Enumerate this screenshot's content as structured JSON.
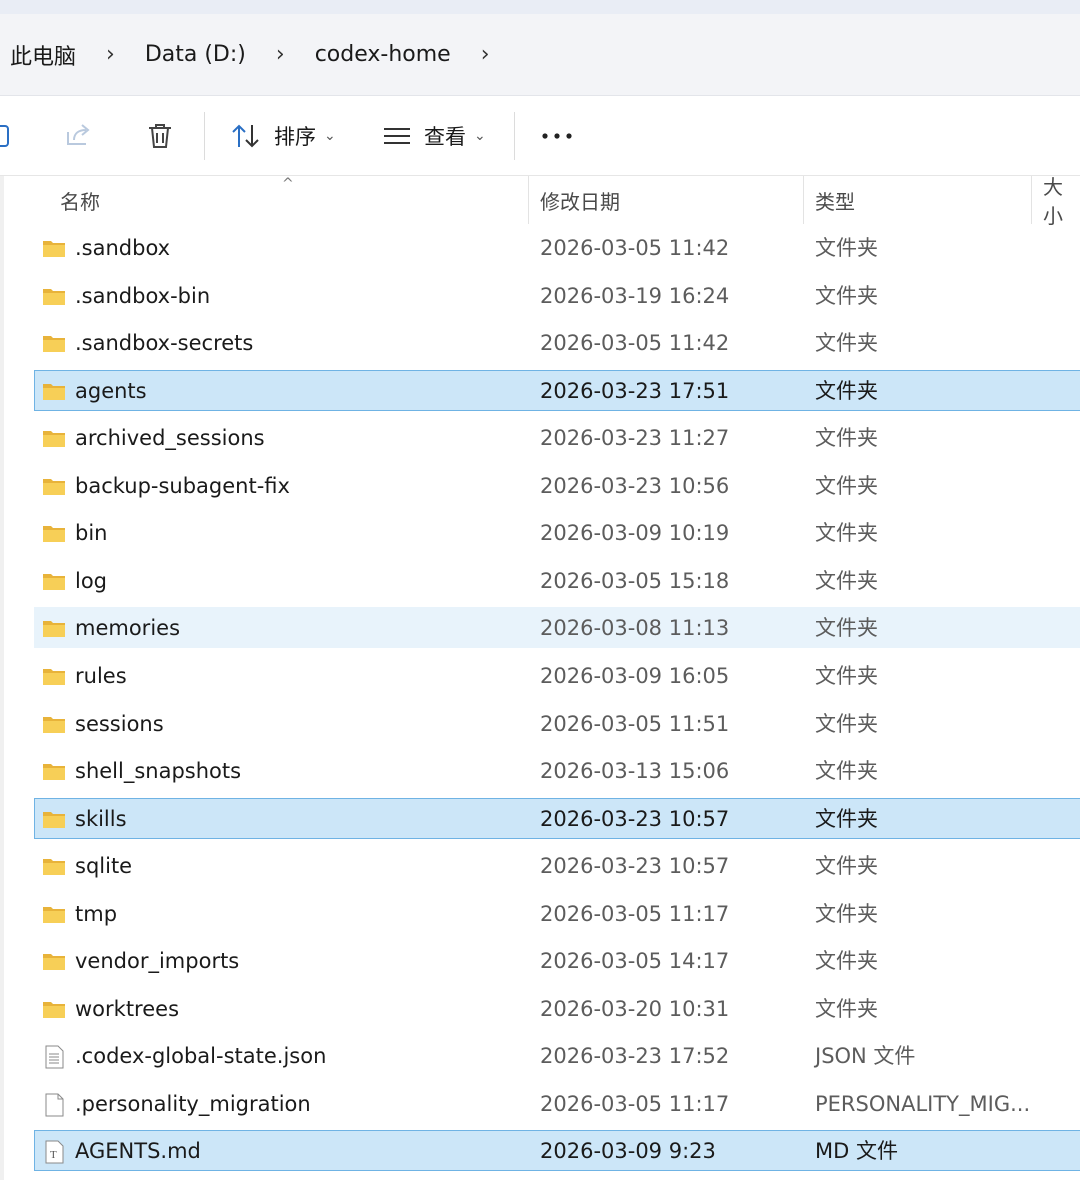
{
  "breadcrumb": [
    "此电脑",
    "Data (D:)",
    "codex-home"
  ],
  "toolbar": {
    "sort_label": "排序",
    "view_label": "查看"
  },
  "columns": {
    "name": "名称",
    "modified": "修改日期",
    "type": "类型",
    "size": "大小"
  },
  "files": [
    {
      "name": ".sandbox",
      "date": "2026-03-05 11:42",
      "type": "文件夹",
      "kind": "folder",
      "state": ""
    },
    {
      "name": ".sandbox-bin",
      "date": "2026-03-19 16:24",
      "type": "文件夹",
      "kind": "folder",
      "state": ""
    },
    {
      "name": ".sandbox-secrets",
      "date": "2026-03-05 11:42",
      "type": "文件夹",
      "kind": "folder",
      "state": ""
    },
    {
      "name": "agents",
      "date": "2026-03-23 17:51",
      "type": "文件夹",
      "kind": "folder",
      "state": "selected"
    },
    {
      "name": "archived_sessions",
      "date": "2026-03-23 11:27",
      "type": "文件夹",
      "kind": "folder",
      "state": ""
    },
    {
      "name": "backup-subagent-fix",
      "date": "2026-03-23 10:56",
      "type": "文件夹",
      "kind": "folder",
      "state": ""
    },
    {
      "name": "bin",
      "date": "2026-03-09 10:19",
      "type": "文件夹",
      "kind": "folder",
      "state": ""
    },
    {
      "name": "log",
      "date": "2026-03-05 15:18",
      "type": "文件夹",
      "kind": "folder",
      "state": ""
    },
    {
      "name": "memories",
      "date": "2026-03-08 11:13",
      "type": "文件夹",
      "kind": "folder",
      "state": "hover"
    },
    {
      "name": "rules",
      "date": "2026-03-09 16:05",
      "type": "文件夹",
      "kind": "folder",
      "state": ""
    },
    {
      "name": "sessions",
      "date": "2026-03-05 11:51",
      "type": "文件夹",
      "kind": "folder",
      "state": ""
    },
    {
      "name": "shell_snapshots",
      "date": "2026-03-13 15:06",
      "type": "文件夹",
      "kind": "folder",
      "state": ""
    },
    {
      "name": "skills",
      "date": "2026-03-23 10:57",
      "type": "文件夹",
      "kind": "folder",
      "state": "selected"
    },
    {
      "name": "sqlite",
      "date": "2026-03-23 10:57",
      "type": "文件夹",
      "kind": "folder",
      "state": ""
    },
    {
      "name": "tmp",
      "date": "2026-03-05 11:17",
      "type": "文件夹",
      "kind": "folder",
      "state": ""
    },
    {
      "name": "vendor_imports",
      "date": "2026-03-05 14:17",
      "type": "文件夹",
      "kind": "folder",
      "state": ""
    },
    {
      "name": "worktrees",
      "date": "2026-03-20 10:31",
      "type": "文件夹",
      "kind": "folder",
      "state": ""
    },
    {
      "name": ".codex-global-state.json",
      "date": "2026-03-23 17:52",
      "type": "JSON 文件",
      "kind": "json",
      "state": ""
    },
    {
      "name": ".personality_migration",
      "date": "2026-03-05 11:17",
      "type": "PERSONALITY_MIG...",
      "kind": "blank",
      "state": ""
    },
    {
      "name": "AGENTS.md",
      "date": "2026-03-09 9:23",
      "type": "MD 文件",
      "kind": "text",
      "state": "selected"
    }
  ],
  "colors": {
    "selected_bg": "#cce6f8",
    "selected_border": "#6fb3e4",
    "folder": "#f6c544",
    "accent": "#0a64c8"
  }
}
